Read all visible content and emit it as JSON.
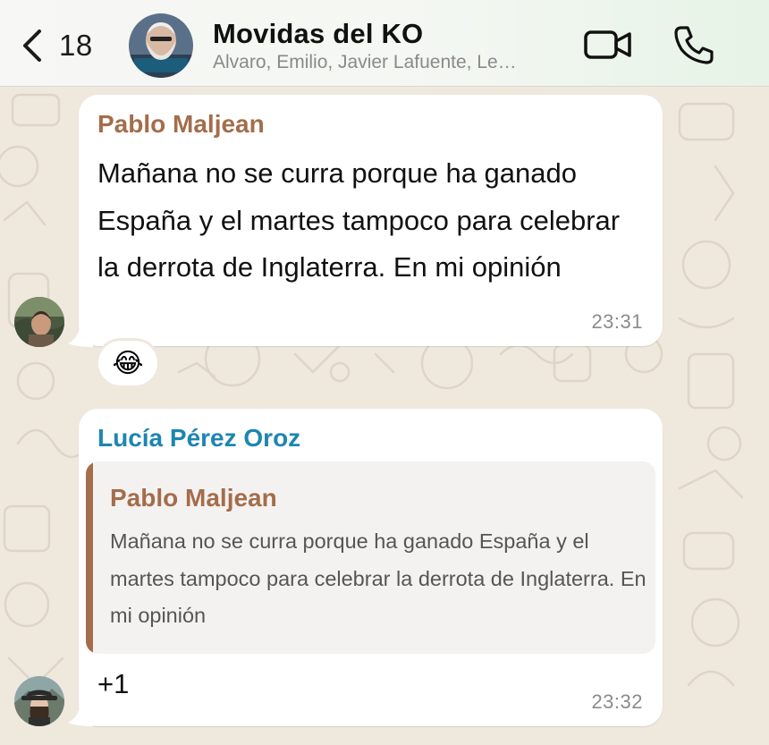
{
  "header": {
    "back_count": "18",
    "title": "Movidas del KO",
    "subtitle": "Alvaro, Emilio, Javier Lafuente, Le…",
    "icons": {
      "back": "chevron-left-icon",
      "video": "video-camera-icon",
      "call": "phone-icon"
    }
  },
  "messages": [
    {
      "sender": "Pablo Maljean",
      "text": "Mañana no se curra porque ha ganado España y el martes tampoco para celebrar la derrota de Inglaterra. En mi opinión",
      "time": "23:31",
      "reaction": "😂"
    },
    {
      "sender": "Lucía Pérez Oroz",
      "quote": {
        "sender": "Pablo Maljean",
        "text": "Mañana no se curra porque ha ganado España y el martes tampoco para celebrar la derrota de Inglaterra. En mi opinión"
      },
      "text": "+1",
      "time": "23:32"
    }
  ],
  "colors": {
    "sender_pablo": "#a46d4b",
    "sender_lucia": "#1d86b0",
    "wallpaper": "#efe8dd",
    "bubble": "#ffffff"
  }
}
